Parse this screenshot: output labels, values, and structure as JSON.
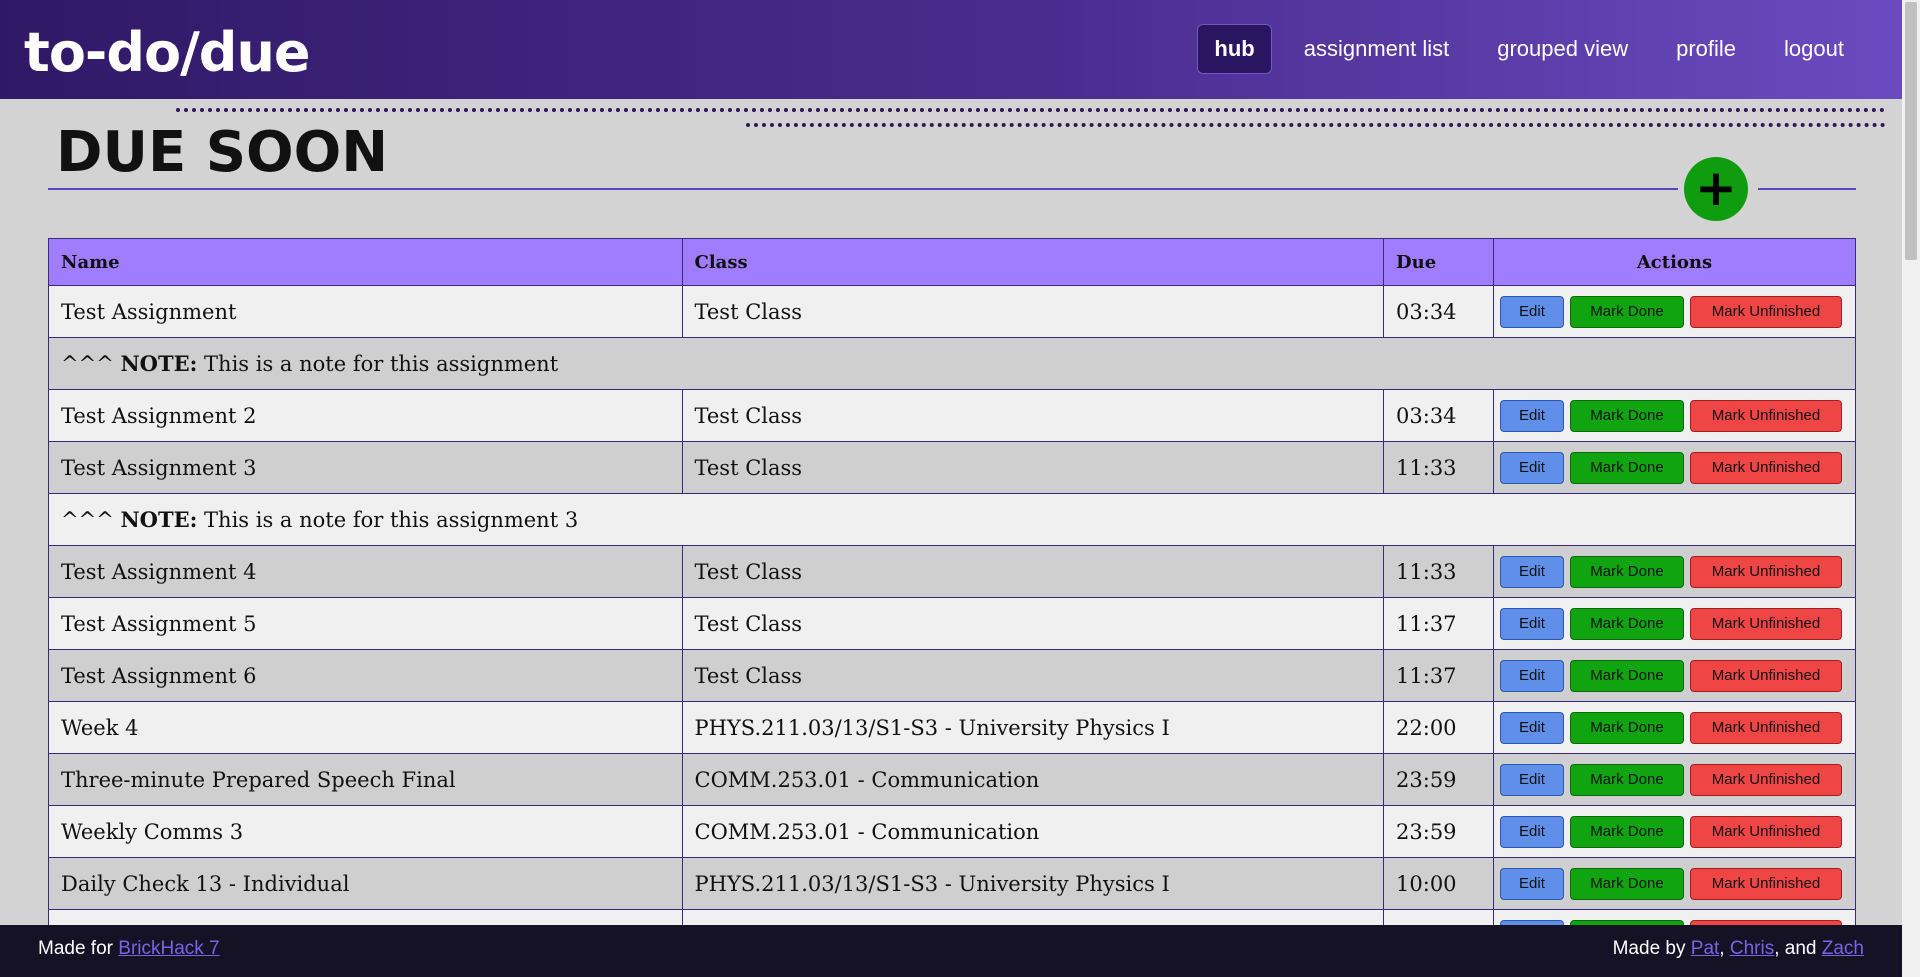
{
  "header": {
    "logo_text": "to-do/due",
    "nav": [
      {
        "label": "hub",
        "active": true
      },
      {
        "label": "assignment list"
      },
      {
        "label": "grouped view"
      },
      {
        "label": "profile"
      },
      {
        "label": "logout"
      }
    ]
  },
  "page": {
    "title": "DUE SOON",
    "add_button": "+"
  },
  "table": {
    "headers": {
      "name": "Name",
      "class": "Class",
      "due": "Due",
      "actions": "Actions"
    },
    "buttons": {
      "edit": "Edit",
      "mark_done": "Mark Done",
      "mark_unfinished": "Mark Unfinished"
    },
    "note_prefix": "^^^",
    "note_label": "NOTE:",
    "rows": [
      {
        "type": "item",
        "name": "Test Assignment",
        "class": "Test Class",
        "due": "03:34"
      },
      {
        "type": "note",
        "text": "This is a note for this assignment"
      },
      {
        "type": "item",
        "name": "Test Assignment 2",
        "class": "Test Class",
        "due": "03:34"
      },
      {
        "type": "item",
        "name": "Test Assignment 3",
        "class": "Test Class",
        "due": "11:33"
      },
      {
        "type": "note",
        "text": "This is a note for this assignment 3"
      },
      {
        "type": "item",
        "name": "Test Assignment 4",
        "class": "Test Class",
        "due": "11:33"
      },
      {
        "type": "item",
        "name": "Test Assignment 5",
        "class": "Test Class",
        "due": "11:37"
      },
      {
        "type": "item",
        "name": "Test Assignment 6",
        "class": "Test Class",
        "due": "11:37"
      },
      {
        "type": "item",
        "name": "Week 4",
        "class": "PHYS.211.03/13/S1-S3 - University Physics I",
        "due": "22:00"
      },
      {
        "type": "item",
        "name": "Three-minute Prepared Speech Final",
        "class": "COMM.253.01 - Communication",
        "due": "23:59"
      },
      {
        "type": "item",
        "name": "Weekly Comms 3",
        "class": "COMM.253.01 - Communication",
        "due": "23:59"
      },
      {
        "type": "item",
        "name": "Daily Check 13 - Individual",
        "class": "PHYS.211.03/13/S1-S3 - University Physics I",
        "due": "10:00"
      },
      {
        "type": "item",
        "name": "",
        "class": "",
        "due": ""
      }
    ]
  },
  "footer": {
    "made_for_prefix": "Made for",
    "made_for_link": "BrickHack 7",
    "made_by_prefix": "Made by",
    "authors": [
      "Pat",
      "Chris",
      "Zach"
    ],
    "sep": ",",
    "and": ", and"
  }
}
